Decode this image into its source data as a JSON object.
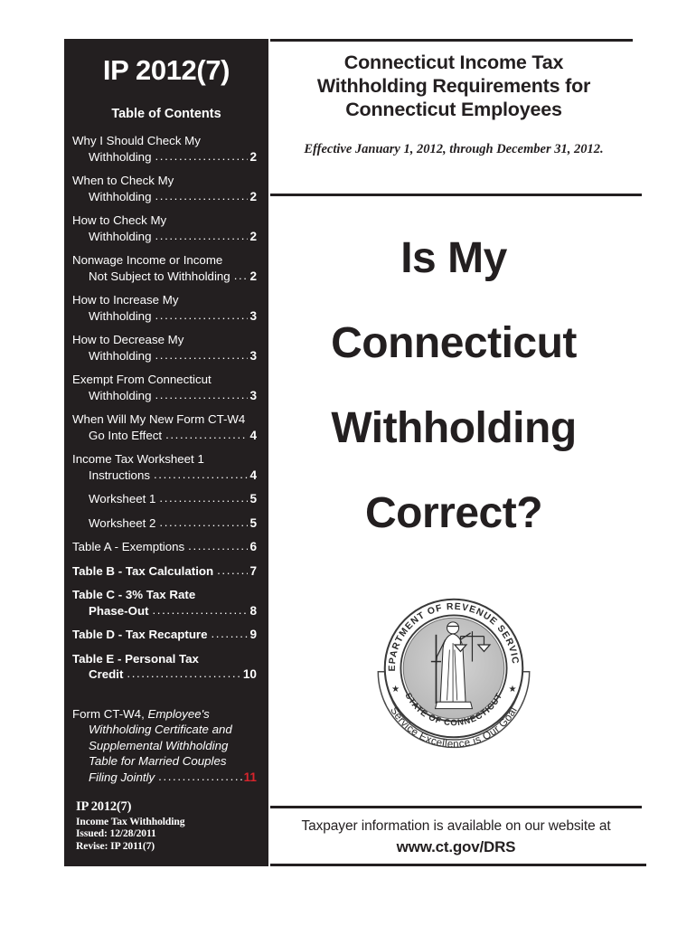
{
  "document": {
    "number": "IP 2012(7)",
    "toc_heading": "Table of Contents"
  },
  "toc": {
    "entries": [
      {
        "line1": "Why I Should Check My",
        "line2": "Withholding",
        "page": "2",
        "bold": false,
        "italic": false
      },
      {
        "line1": "When to Check My",
        "line2": "Withholding",
        "page": "2",
        "bold": false,
        "italic": false
      },
      {
        "line1": "How to Check My",
        "line2": "Withholding",
        "page": "2",
        "bold": false,
        "italic": false
      },
      {
        "line1": "Nonwage Income or Income",
        "line2": "Not Subject to Withholding",
        "page": "2",
        "bold": false,
        "italic": false
      },
      {
        "line1": "How to Increase My",
        "line2": "Withholding",
        "page": "3",
        "bold": false,
        "italic": false
      },
      {
        "line1": "How to Decrease My",
        "line2": "Withholding",
        "page": "3",
        "bold": false,
        "italic": false
      },
      {
        "line1": "Exempt From Connecticut",
        "line2": "Withholding",
        "page": "3",
        "bold": false,
        "italic": false
      },
      {
        "line1": "When Will My New Form CT-W4",
        "line2": "Go Into Effect",
        "page": "4",
        "bold": false,
        "italic": false
      },
      {
        "line1": "Income Tax Worksheet 1",
        "line2": "Instructions",
        "page": "4",
        "bold": false,
        "italic": false
      },
      {
        "line1": "",
        "line2": "Worksheet 1",
        "page": "5",
        "bold": false,
        "italic": false
      },
      {
        "line1": "",
        "line2": "Worksheet 2",
        "page": "5",
        "bold": false,
        "italic": false
      },
      {
        "line1": "",
        "line2": "Table A - Exemptions",
        "page": "6",
        "bold": false,
        "italic": false,
        "flush": true
      },
      {
        "line1": "",
        "line2": "Table B - Tax Calculation",
        "page": "7",
        "bold": true,
        "italic": false,
        "flush": true
      },
      {
        "line1": "Table C - 3% Tax Rate",
        "line2": "Phase-Out",
        "page": "8",
        "bold": true,
        "italic": false
      },
      {
        "line1": "",
        "line2": "Table D - Tax Recapture",
        "page": "9",
        "bold": true,
        "italic": false,
        "flush": true
      },
      {
        "line1": "Table E - Personal Tax",
        "line2": "Credit",
        "page": "10",
        "bold": true,
        "italic": false
      }
    ],
    "last_entry": {
      "prefix": "Form CT-W4,",
      "italic_lines": [
        "Employee's",
        "Withholding Certificate and",
        "Supplemental Withholding",
        "Table for Married Couples",
        "Filing Jointly"
      ],
      "page": "11",
      "page_color": "#d8242c"
    }
  },
  "doc_footer": {
    "title": "IP 2012(7)",
    "lines": [
      "Income Tax Withholding",
      "Issued: 12/28/2011",
      "Revise: IP 2011(7)"
    ]
  },
  "header": {
    "title_lines": [
      "Connecticut Income Tax",
      "Withholding Requirements for",
      "Connecticut Employees"
    ],
    "effective": "Effective January 1, 2012, through December 31, 2012."
  },
  "hero": {
    "lines": [
      "Is My",
      "Connecticut",
      "Withholding",
      "Correct?"
    ]
  },
  "seal": {
    "outer_text": "DEPARTMENT OF REVENUE SERVICES",
    "inner_text": "STATE OF CONNECTICUT",
    "ribbon_text": "Service Excellence is Our Goal",
    "figure": "lady-justice-with-scales"
  },
  "footer": {
    "line1": "Taxpayer information is available on our website at",
    "line2": "www.ct.gov/DRS"
  },
  "colors": {
    "panel_background": "#231f20",
    "ink": "#231f20",
    "panel_text": "#ffffff",
    "accent_red": "#d8242c"
  }
}
